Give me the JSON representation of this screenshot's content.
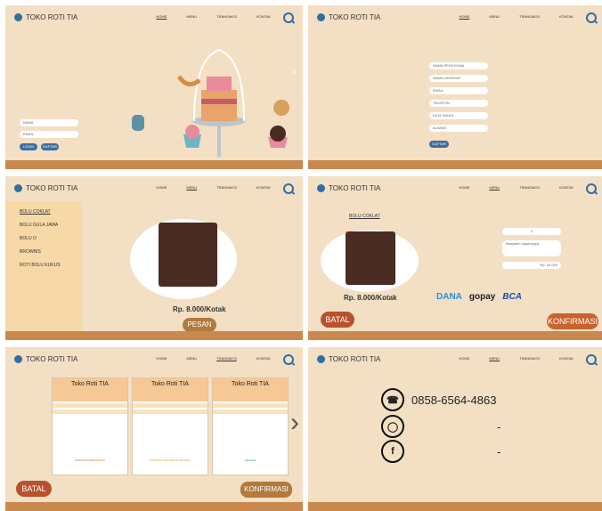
{
  "brand": "TOKO ROTI TIA",
  "nav": [
    "HOME",
    "MENU",
    "TRANSAKSI",
    "KONTAK"
  ],
  "panel1": {
    "fields": [
      "NAMA",
      "EMAIL"
    ],
    "buttons": [
      "LOGIN",
      "DAFTAR"
    ]
  },
  "panel2": {
    "fields": [
      "NAMA PENGGUNA",
      "NAMA LENGKAP",
      "EMAIL",
      "TELEPON",
      "KATA SANDI",
      "ALAMAT"
    ],
    "button": "DAFTAR"
  },
  "panel3": {
    "categories": [
      "BOLU COKLAT",
      "BOLU GULA JAWA",
      "BOLU O",
      "BROWNIS",
      "ROTI BOLU KUKUS"
    ],
    "price": "Rp. 8.000/Kotak",
    "button": "PESAN"
  },
  "panel4": {
    "title": "BOLU COKLAT",
    "qty": "2",
    "note": "Banyakin toppingnya",
    "total": "Rp. 16.000",
    "price": "Rp. 8.000/Kotak",
    "payments": [
      "DANA",
      "gopay",
      "BCA"
    ],
    "cancel": "BATAL",
    "confirm": "KONFIRMASI"
  },
  "panel5": {
    "receipt_title": "Toko Roti TIA",
    "receipts": [
      {
        "status": "PESANAN DIBATALKAN",
        "color": "#d06a2a"
      },
      {
        "status": "PESANAN SEDANG DI PROSES",
        "color": "#d0a82a"
      },
      {
        "status": "SELESAI",
        "color": "#3aa35a"
      }
    ],
    "cancel": "BATAL",
    "confirm": "KONFIRMASI"
  },
  "panel6": {
    "phone": "0858-6564-4863",
    "instagram": "-",
    "facebook": "-"
  }
}
